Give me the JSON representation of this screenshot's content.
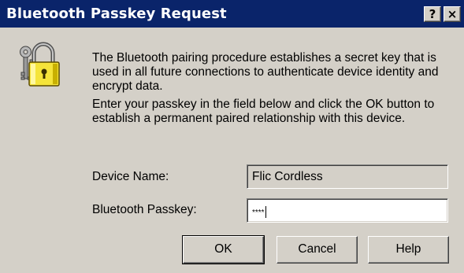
{
  "window": {
    "title": "Bluetooth Passkey Request",
    "help_glyph": "?",
    "close_glyph": "×"
  },
  "icon": "lock-keys-icon",
  "text": {
    "para1": "The Bluetooth pairing procedure establishes a secret key that is used in all future connections to authenticate device identity and encrypt data.",
    "para2": "Enter your passkey in the field below and click the OK button to establish a permanent paired relationship with this device."
  },
  "form": {
    "device_label": "Device Name:",
    "device_value": "Flic Cordless",
    "passkey_label": "Bluetooth Passkey:",
    "passkey_value": "****"
  },
  "buttons": {
    "ok": "OK",
    "cancel": "Cancel",
    "help": "Help"
  },
  "colors": {
    "titlebar": "#0a246a",
    "face": "#d4d0c8"
  }
}
